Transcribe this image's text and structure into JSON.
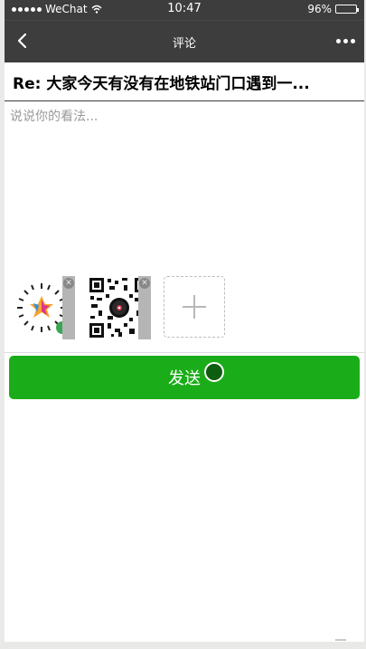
{
  "status_bar": {
    "carrier": "WeChat",
    "time": "10:47",
    "battery": "96%",
    "battery_level": 0.96
  },
  "navbar": {
    "title": "评论",
    "back_icon": "chevron-left-icon",
    "more_icon": "more-dots-icon"
  },
  "post": {
    "title": "Re: 大家今天有没有在地铁站门口遇到一..."
  },
  "comment": {
    "placeholder": "说说你的看法..."
  },
  "send": {
    "label": "发送"
  },
  "colors": {
    "send_green": "#1aad19",
    "nav_bg": "#3d3d3d"
  }
}
